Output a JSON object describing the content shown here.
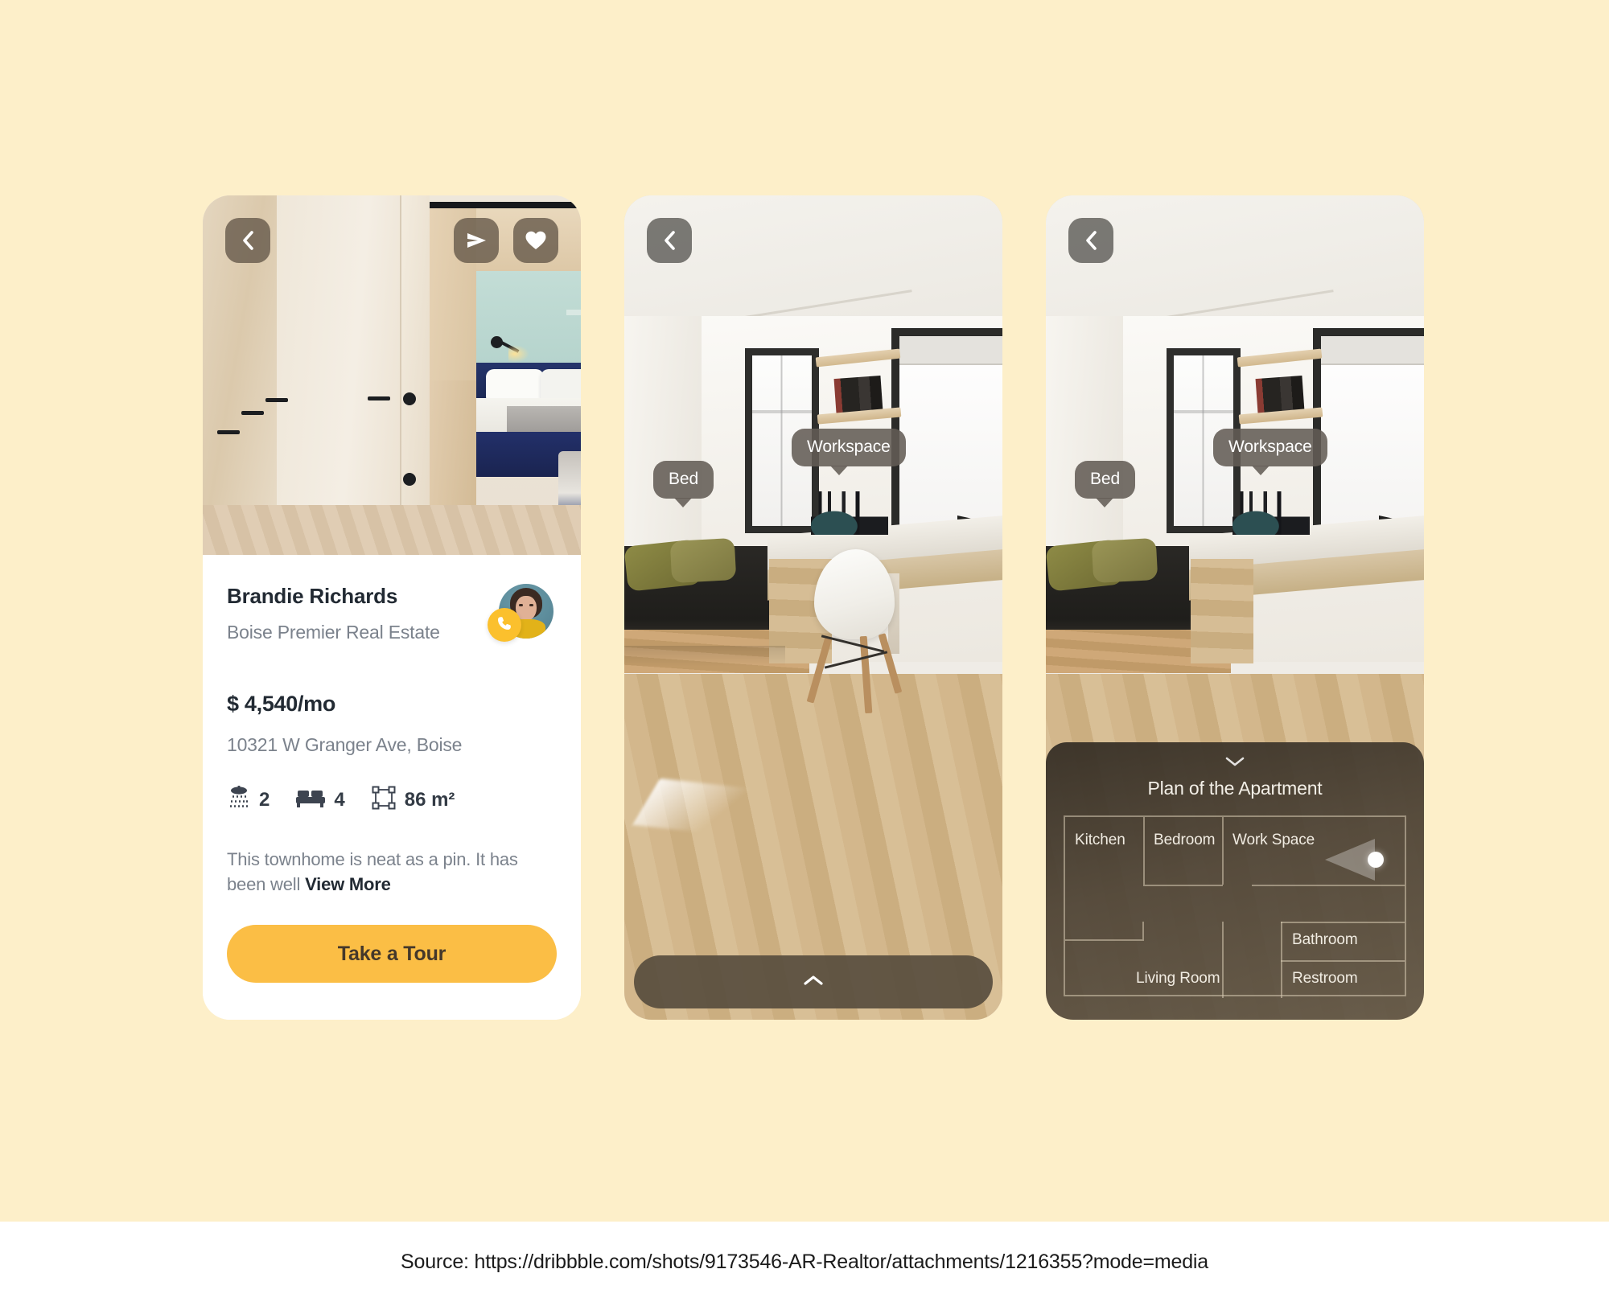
{
  "background_color": "#FDEFC9",
  "accent_color": "#FBBE45",
  "source": {
    "label": "Source: https://dribbble.com/shots/9173546-AR-Realtor/attachments/1216355?mode=media"
  },
  "screen1": {
    "toolbar": {
      "back_icon": "chevron-left-icon",
      "share_icon": "send-icon",
      "favorite_icon": "heart-icon"
    },
    "agent": {
      "name": "Brandie Richards",
      "agency": "Boise Premier Real Estate",
      "call_icon": "phone-icon",
      "avatar_alt": "agent-avatar"
    },
    "listing": {
      "price": "$ 4,540/mo",
      "address": "10321 W Granger Ave, Boise",
      "specs": [
        {
          "icon": "shower-icon",
          "value": "2"
        },
        {
          "icon": "bed-icon",
          "value": "4"
        },
        {
          "icon": "area-icon",
          "value": "86 m²"
        }
      ],
      "description": "This townhome is neat as a pin. It has been well ",
      "view_more": "View More"
    },
    "cta": {
      "label": "Take a Tour"
    }
  },
  "screen2": {
    "toolbar": {
      "back_icon": "chevron-left-icon"
    },
    "ar_labels": [
      {
        "text": "Bed"
      },
      {
        "text": "Workspace"
      }
    ],
    "bottom_handle": {
      "icon": "chevron-up-icon"
    }
  },
  "screen3": {
    "toolbar": {
      "back_icon": "chevron-left-icon"
    },
    "ar_labels": [
      {
        "text": "Bed"
      },
      {
        "text": "Workspace"
      }
    ],
    "plan": {
      "grip_icon": "chevron-down-icon",
      "title": "Plan of the Apartment",
      "rooms": [
        {
          "name": "Kitchen"
        },
        {
          "name": "Bedroom"
        },
        {
          "name": "Work Space"
        },
        {
          "name": "Living Room"
        },
        {
          "name": "Bathroom"
        },
        {
          "name": "Restroom"
        }
      ],
      "viewer_marker": "current-position-marker"
    }
  }
}
